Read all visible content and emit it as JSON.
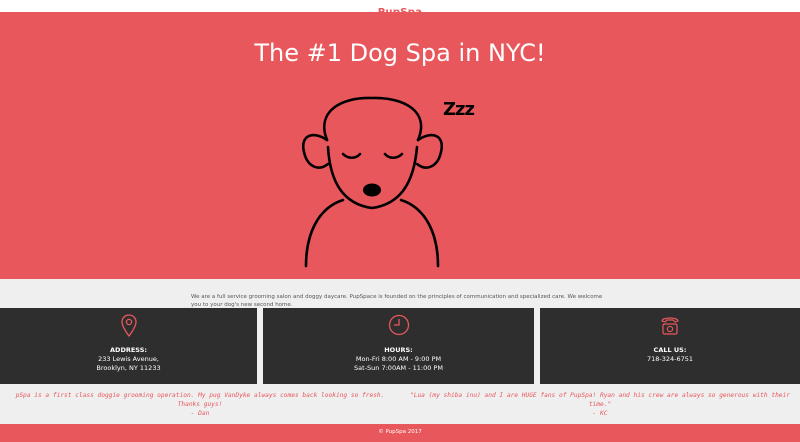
{
  "header": {
    "brand": "PupSpa"
  },
  "hero": {
    "title": "The #1 Dog Spa in NYC!",
    "sleep_text": "Zzz"
  },
  "about": {
    "text": "We are a full service grooming salon and doggy daycare. PupSpace is founded on the principles of communication and specialized care. We welcome you to your dog's new second home."
  },
  "info_cards": [
    {
      "icon": "map-pin-icon",
      "label": "ADDRESS:",
      "lines": [
        "233 Lewis Avenue,",
        "Brooklyn, NY 11233"
      ]
    },
    {
      "icon": "clock-icon",
      "label": "HOURS:",
      "lines": [
        "Mon-Fri 8:00 AM - 9:00 PM",
        "Sat-Sun 7:00AM - 11:00 PM"
      ]
    },
    {
      "icon": "telephone-icon",
      "label": "CALL US:",
      "lines": [
        "718-324-6751"
      ]
    }
  ],
  "testimonials": [
    {
      "lines": [
        "pSpa is a first class doggie grooming operation. My pug VanDyke always comes back looking so fresh.",
        "Thanks guys!",
        "- Dan"
      ]
    },
    {
      "lines": [
        "\"Lua (my shiba inu) and I are HUGE fans of PupSpa! Ryan and his crew are always so generous with their",
        "time.\"",
        "- KC"
      ]
    }
  ],
  "footer": {
    "copyright": "© PupSpa 2017"
  },
  "colors": {
    "brand_red": "#e8575c",
    "dark_card": "#2e2e2e",
    "background": "#efefef"
  }
}
